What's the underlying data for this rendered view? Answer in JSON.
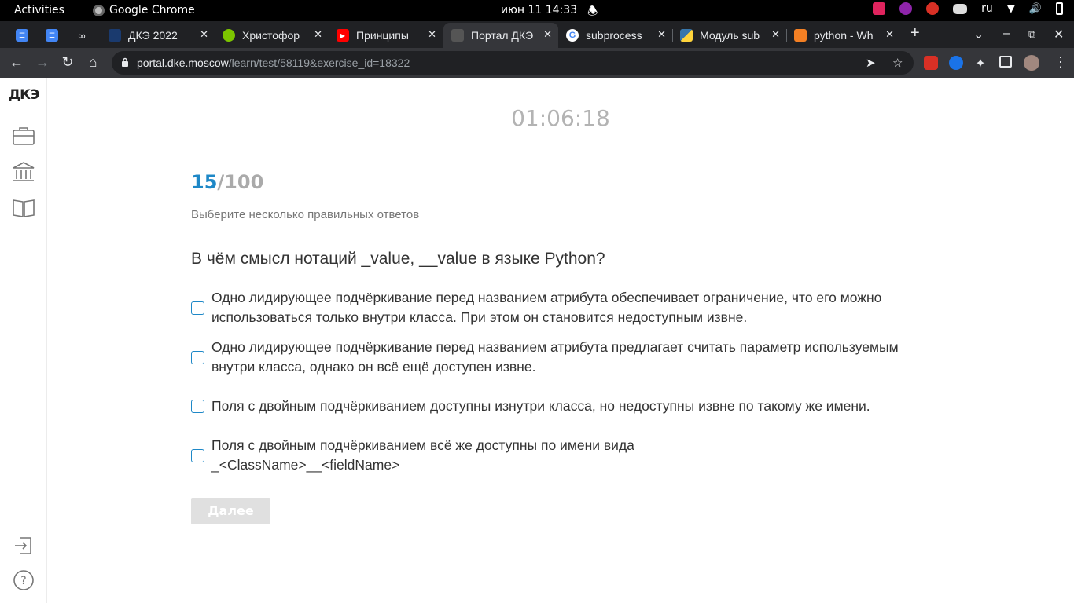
{
  "system_bar": {
    "activities": "Activities",
    "app_name": "Google Chrome",
    "clock": "июн 11  14:33",
    "keyboard_layout": "ru"
  },
  "tabs": [
    {
      "label": "",
      "icon": "docs-icon",
      "color": "#4285f4"
    },
    {
      "label": "",
      "icon": "docs-icon",
      "color": "#4285f4"
    },
    {
      "label": "",
      "icon": "link-icon",
      "color": "#202124"
    },
    {
      "label": "ДКЭ 2022",
      "icon": "dke-favicon",
      "color": "#1a3a6e"
    },
    {
      "label": "Христофор",
      "icon": "green-circle-favicon",
      "color": "#7cc500"
    },
    {
      "label": "Принципы",
      "icon": "youtube-icon",
      "color": "#ff0000"
    },
    {
      "label": "Портал ДКЭ",
      "icon": "dke-favicon",
      "color": "#555555"
    },
    {
      "label": "subprocess",
      "icon": "google-icon",
      "color": "#4285f4"
    },
    {
      "label": "Модуль sub",
      "icon": "python-icon",
      "color": "#3776ab"
    },
    {
      "label": "python - Wh",
      "icon": "stackoverflow-icon",
      "color": "#f48024"
    }
  ],
  "address_bar": {
    "host": "portal.dke.moscow",
    "path": "/learn/test/58119&exercise_id=18322"
  },
  "sidebar": {
    "logo_text": "ДКЭ"
  },
  "test": {
    "timer": "01:06:18",
    "current": "15",
    "total": "/100",
    "instruction": "Выберите несколько правильных ответов",
    "question": "В чём смысл нотаций _value, __value в языке Python?",
    "options": [
      "Одно лидирующее подчёркивание перед названием атрибута обеспечивает ограничение, что его можно использоваться только внутри класса. При этом он становится недоступным извне.",
      "Одно лидирующее подчёркивание перед названием атрибута предлагает считать параметр используемым внутри класса, однако он всё ещё доступен извне.",
      "Поля с двойным подчёркиванием доступны изнутри класса, но недоступны извне по такому же имени.",
      "Поля с двойным подчёркиванием всё же доступны по имени вида _<ClassName>__<fieldName>"
    ],
    "next_label": "Далее"
  },
  "colors": {
    "accent": "#1e88c7",
    "timer": "#b3b3b3",
    "button_disabled": "#e0e0e0"
  }
}
